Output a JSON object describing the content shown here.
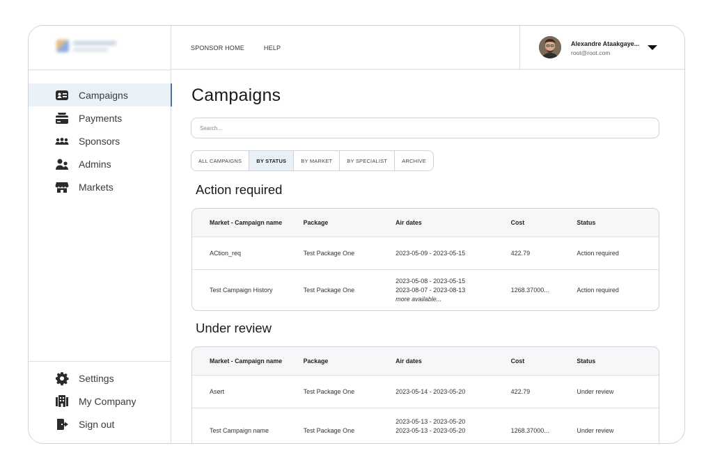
{
  "sidebar": {
    "items": [
      {
        "label": "Campaigns",
        "icon": "id-card-icon"
      },
      {
        "label": "Payments",
        "icon": "payments-icon"
      },
      {
        "label": "Sponsors",
        "icon": "users-group-icon"
      },
      {
        "label": "Admins",
        "icon": "admins-icon"
      },
      {
        "label": "Markets",
        "icon": "store-icon"
      }
    ],
    "bottom_items": [
      {
        "label": "Settings",
        "icon": "gear-icon"
      },
      {
        "label": "My Company",
        "icon": "building-icon"
      },
      {
        "label": "Sign out",
        "icon": "sign-out-icon"
      }
    ]
  },
  "topbar": {
    "links": [
      "SPONSOR HOME",
      "HELP"
    ],
    "user": {
      "name": "Alexandre Ataakgaye...",
      "email": "root@root.com"
    }
  },
  "main": {
    "title": "Campaigns",
    "search_placeholder": "Search...",
    "tabs": [
      "ALL CAMPAIGNS",
      "BY STATUS",
      "BY MARKET",
      "BY SPECIALIST",
      "ARCHIVE"
    ],
    "active_tab": "BY STATUS",
    "columns": [
      "Market - Campaign name",
      "Package",
      "Air dates",
      "Cost",
      "Status"
    ],
    "sections": [
      {
        "title": "Action required",
        "rows": [
          {
            "name": "ACtion_req",
            "package": "Test Package One",
            "air_dates": [
              "2023-05-09 - 2023-05-15"
            ],
            "more": "",
            "cost": "422.79",
            "status": "Action required"
          },
          {
            "name": "Test Campaign History",
            "package": "Test Package One",
            "air_dates": [
              "2023-05-08 - 2023-05-15",
              "2023-08-07 - 2023-08-13"
            ],
            "more": "more available...",
            "cost": "1268.37000...",
            "status": "Action required"
          }
        ]
      },
      {
        "title": "Under review",
        "rows": [
          {
            "name": "Asert",
            "package": "Test Package One",
            "air_dates": [
              "2023-05-14 - 2023-05-20"
            ],
            "more": "",
            "cost": "422.79",
            "status": "Under review"
          },
          {
            "name": "Test Campaign name",
            "package": "Test Package One",
            "air_dates": [
              "2023-05-13 - 2023-05-20",
              "2023-05-13 - 2023-05-20"
            ],
            "more": "",
            "cost": "1268.37000...",
            "status": "Under review"
          }
        ]
      }
    ]
  },
  "colors": {
    "accent": "#4a6f98",
    "active_bg": "#e9f0f8",
    "border": "#cfd3d8"
  }
}
